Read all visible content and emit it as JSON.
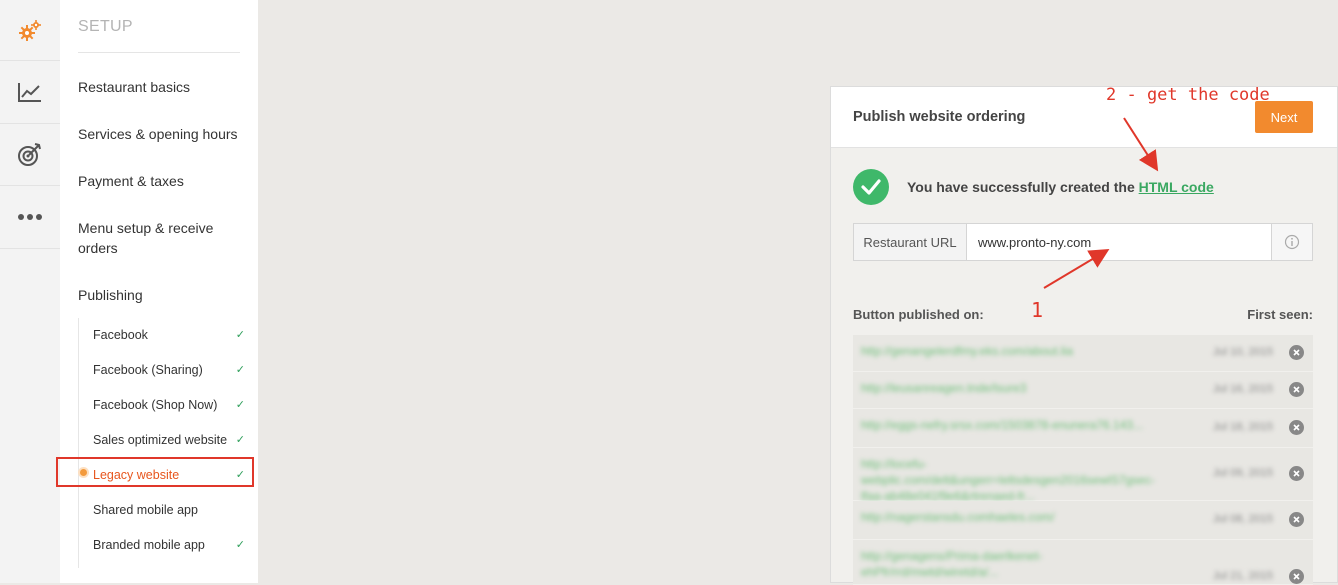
{
  "rail": {
    "items": [
      {
        "icon": "gear-icon"
      },
      {
        "icon": "chart-icon"
      },
      {
        "icon": "target-icon"
      },
      {
        "icon": "more-icon"
      }
    ]
  },
  "setup": {
    "title": "SETUP",
    "nav": [
      "Restaurant basics",
      "Services & opening hours",
      "Payment & taxes",
      "Menu setup & receive orders",
      "Publishing"
    ],
    "subnav": [
      {
        "label": "Facebook",
        "checked": true
      },
      {
        "label": "Facebook (Sharing)",
        "checked": true
      },
      {
        "label": "Facebook (Shop Now)",
        "checked": true
      },
      {
        "label": "Sales optimized website",
        "checked": true
      },
      {
        "label": "Legacy website",
        "checked": true,
        "active": true
      },
      {
        "label": "Shared mobile app",
        "checked": false
      },
      {
        "label": "Branded mobile app",
        "checked": true
      }
    ],
    "check_glyph": "✓"
  },
  "panel": {
    "title": "Publish website ordering",
    "next_label": "Next",
    "success_prefix": "You have successfully created the ",
    "success_link": "HTML code",
    "url_label": "Restaurant URL",
    "url_value": "www.pronto-ny.com",
    "list_left": "Button published on:",
    "list_right": "First seen:",
    "rows": [
      {
        "url": "http://genangelerdfmy.eks.com/about.lia",
        "date": "Jul 10, 2015"
      },
      {
        "url": "http://leusanreagen.tnde/lsure3",
        "date": "Jul 16, 2015"
      },
      {
        "url": "http://eggs-nefry.srsx.com/1503878-enunera76.143...",
        "date": "Jul 18, 2015"
      },
      {
        "url": "http://locefu-webplic.com/delt&ungerr=leltsdesgen2016sewlS7gsec-lfaa-ab48e041f9e6&rtrenaed-fr...",
        "date": "Jul 09, 2015"
      },
      {
        "url": "http://nagerstansdu.comhaeles.com/",
        "date": "Jul 08, 2015"
      },
      {
        "url": "http://genagens/Prima-daerlkenet-ehPfr/rrd/mwtd/wiretd/a/...",
        "date": "Jul 21, 2015"
      }
    ]
  },
  "annotations": {
    "step2": "2 - get the code",
    "step1": "1",
    "color": "#e0372a"
  },
  "colors": {
    "accent": "#f28a2e",
    "success": "#3fb86a",
    "active_nav": "#e7561e",
    "highlight": "#e0372a"
  }
}
